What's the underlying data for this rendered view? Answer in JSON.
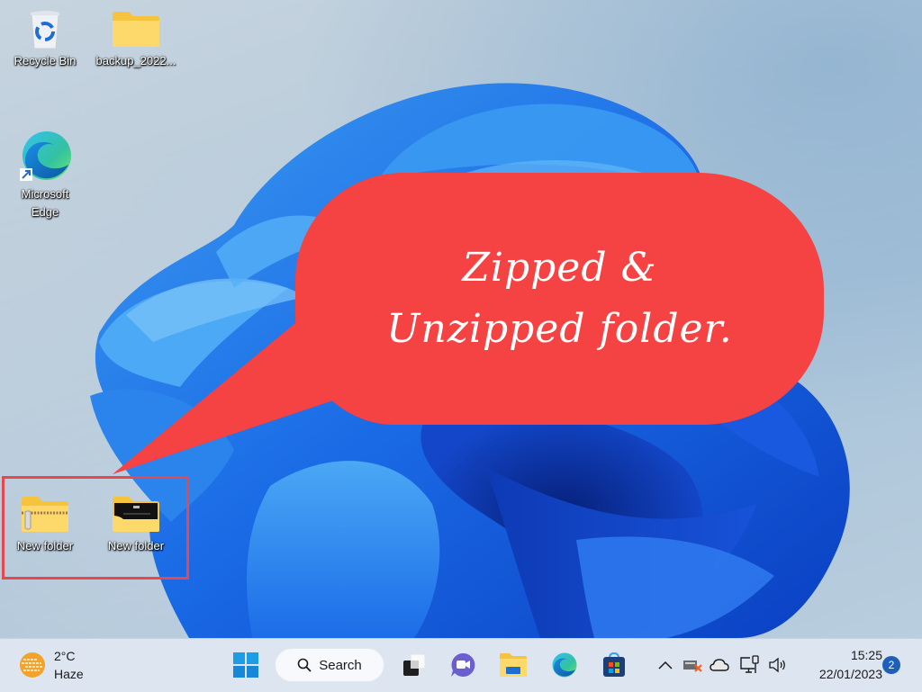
{
  "desktop": {
    "icons": [
      {
        "label": "Recycle Bin",
        "icon": "recycle-bin-icon"
      },
      {
        "label": "backup_2022...",
        "icon": "folder-icon"
      },
      {
        "label": "Microsoft Edge",
        "label_line1": "Microsoft",
        "label_line2": "Edge",
        "icon": "edge-shortcut-icon"
      },
      {
        "label": "New folder",
        "icon": "zipped-folder-icon"
      },
      {
        "label": "New folder",
        "icon": "folder-with-thumbnail-icon"
      }
    ]
  },
  "annotation": {
    "line1": "Zipped &",
    "line2": "Unzipped folder.",
    "bubble_color": "#f54242",
    "box_color": "#e5484d"
  },
  "taskbar": {
    "weather": {
      "temp": "2°C",
      "condition": "Haze",
      "icon": "haze-weather-icon"
    },
    "start_icon": "windows-start-icon",
    "search": {
      "label": "Search",
      "icon": "search-icon"
    },
    "apps": [
      {
        "name": "Task View",
        "icon": "task-view-icon"
      },
      {
        "name": "Teams Chat",
        "icon": "teams-chat-icon"
      },
      {
        "name": "File Explorer",
        "icon": "file-explorer-icon"
      },
      {
        "name": "Microsoft Edge",
        "icon": "edge-icon"
      },
      {
        "name": "Microsoft Store",
        "icon": "store-icon"
      }
    ],
    "tray": {
      "overflow_icon": "chevron-up-icon",
      "icons": [
        "network-disconnected-icon",
        "onedrive-cloud-icon",
        "ethernet-icon",
        "volume-icon"
      ]
    },
    "clock": {
      "time": "15:25",
      "date": "22/01/2023"
    },
    "notifications": "2"
  }
}
